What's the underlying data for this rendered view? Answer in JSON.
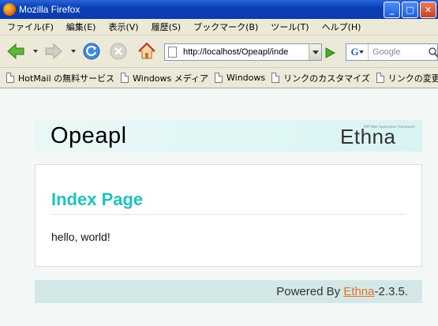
{
  "window": {
    "title": "Mozilla Firefox",
    "buttons": {
      "minimize": "_",
      "maximize": "□",
      "close": "✕"
    }
  },
  "menubar": {
    "items": [
      "ファイル(F)",
      "編集(E)",
      "表示(V)",
      "履歴(S)",
      "ブックマーク(B)",
      "ツール(T)",
      "ヘルプ(H)"
    ]
  },
  "navbar": {
    "url": "http://localhost/Opeapl/inde",
    "search_placeholder": "Google",
    "search_engine_letter": "G"
  },
  "bookmarks": {
    "items": [
      "HotMail の無料サービス",
      "Windows メディア",
      "Windows",
      "リンクのカスタマイズ",
      "リンクの変更"
    ]
  },
  "page": {
    "site_title": "Opeapl",
    "logo": {
      "text": "Ethna",
      "tagline": "PHP Web Application Framework"
    },
    "heading": "Index Page",
    "body": "hello, world!",
    "footer": {
      "prefix": "Powered By ",
      "link": "Ethna",
      "suffix": "-2.3.5."
    }
  },
  "colors": {
    "heading": "#1fc3bd",
    "footer_link": "#e2702a",
    "footer_bg": "#d3e8e6",
    "header_bg": "#d8f4f3"
  }
}
